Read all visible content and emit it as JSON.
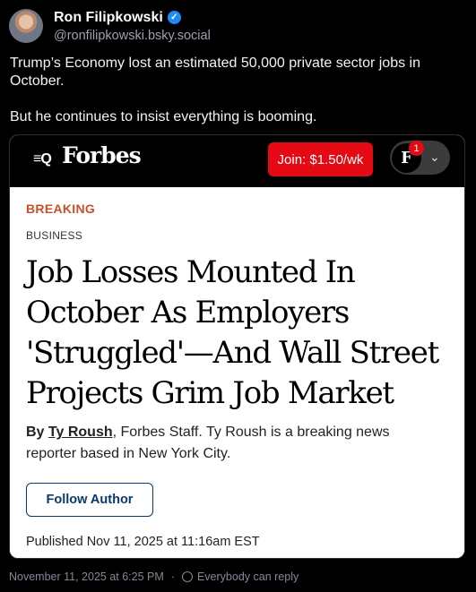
{
  "post": {
    "author_name": "Ron Filipkowski",
    "author_handle": "@ronfilipkowski.bsky.social",
    "text_lines": [
      "Trump’s Economy lost an estimated 50,000 private sector jobs in October.",
      "But he continues to insist everything is booming."
    ],
    "timestamp": "November 11, 2025 at 6:25 PM",
    "reply_setting": "Everybody can reply"
  },
  "card": {
    "brand": "Forbes",
    "menu_glyph": "≡Q",
    "join_label": "Join: $1.50/wk",
    "profile_initial": "F",
    "notification_count": "1",
    "label_breaking": "BREAKING",
    "section": "BUSINESS",
    "headline": "Job Losses Mounted In October As Employers 'Struggled'—And Wall Street Projects Grim Job Market",
    "byline_prefix": "By",
    "byline_author": "Ty Roush",
    "byline_rest": ", Forbes Staff.  Ty Roush is a breaking news reporter based in New York City.",
    "follow_label": "Follow Author",
    "published": "Published Nov 11, 2025 at 11:16am EST"
  },
  "colors": {
    "background": "#000000",
    "verified_badge": "#1d8cf2",
    "breaking_label": "#c8502a",
    "join_button": "#e50914",
    "follow_border": "#0b3a6a"
  },
  "icons": {
    "verified": "verified-check-icon",
    "menu_search": "menu-search-icon",
    "chevron": "chevron-down-icon",
    "reply": "reply-settings-icon"
  }
}
